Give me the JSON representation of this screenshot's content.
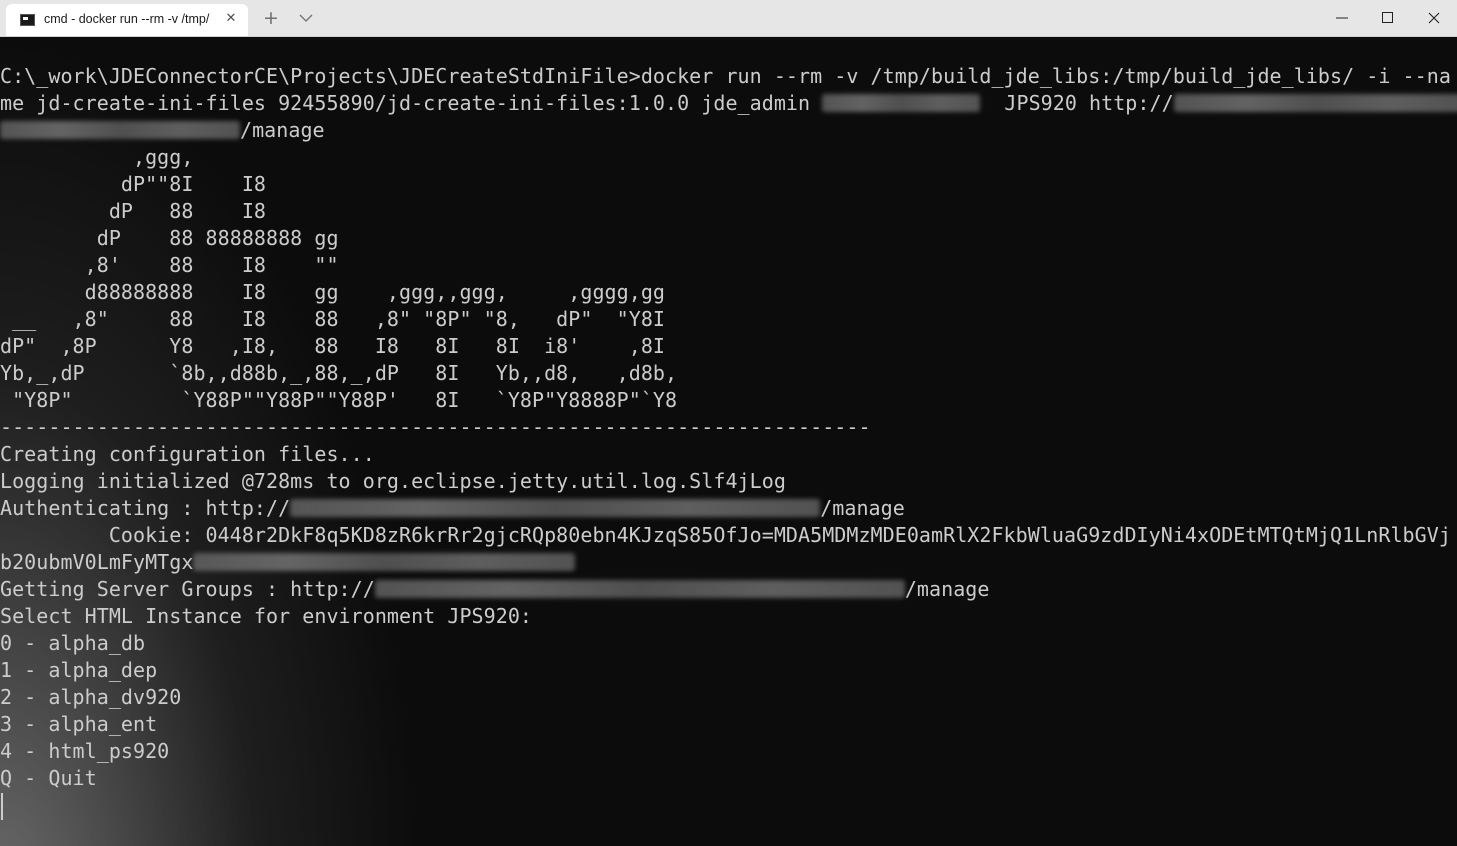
{
  "window": {
    "tab_title": "cmd - docker  run --rm -v /tmp/",
    "tab_close_glyph": "✕",
    "new_tab_glyph": "+"
  },
  "terminal": {
    "lines": [
      "C:\\_work\\JDEConnectorCE\\Projects\\JDECreateStdIniFile>docker run --rm -v /tmp/build_jde_libs:/tmp/build_jde_libs/ -i --na",
      "me jd-create-ini-files 92455890/jd-create-ini-files:1.0.0 jde_admin",
      "/manage",
      "           ,ggg,",
      "          dP\"\"8I    I8",
      "         dP   88    I8",
      "        dP    88 88888888 gg",
      "       ,8'    88    I8    \"\"",
      "       d88888888    I8    gg    ,ggg,,ggg,     ,gggg,gg",
      " __   ,8\"     88    I8    88   ,8\" \"8P\" \"8,   dP\"  \"Y8I",
      "dP\"  ,8P      Y8   ,I8,   88   I8   8I   8I  i8'    ,8I",
      "Yb,_,dP       `8b,,d88b,_,88,_,dP   8I   Yb,,d8,   ,d8b,",
      " \"Y8P\"         `Y88P\"\"Y88P\"\"Y88P'   8I   `Y8P\"Y8888P\"`Y8",
      "------------------------------------------------------------------------",
      "Creating configuration files...",
      "Logging initialized @728ms to org.eclipse.jetty.util.log.Slf4jLog",
      "Authenticating : http://",
      "         Cookie: 0448r2DkF8q5KD8zR6krRr2gjcRQp80ebn4KJzqS85OfJo=MDA5MDMzMDE0amRlX2FkbWluaG9zdDIyNi4xODEtMTQtMjQ1LnRlbGVj",
      "b20ubmV0LmFyMTgx",
      "Getting Server Groups : http://",
      "Select HTML Instance for environment JPS920:",
      "0 - alpha_db",
      "1 - alpha_dep",
      "2 - alpha_dv920",
      "3 - alpha_ent",
      "4 - html_ps920",
      "Q - Quit"
    ],
    "line1_suffix_a": "  JPS920 http://",
    "line3_suffix": "/manage",
    "line16_suffix": "/manage",
    "line19_suffix": "/manage"
  },
  "colors": {
    "terminal_text": "#cccccc",
    "terminal_bg": "#0c0c0c",
    "titlebar_bg": "#e6e6e6"
  }
}
